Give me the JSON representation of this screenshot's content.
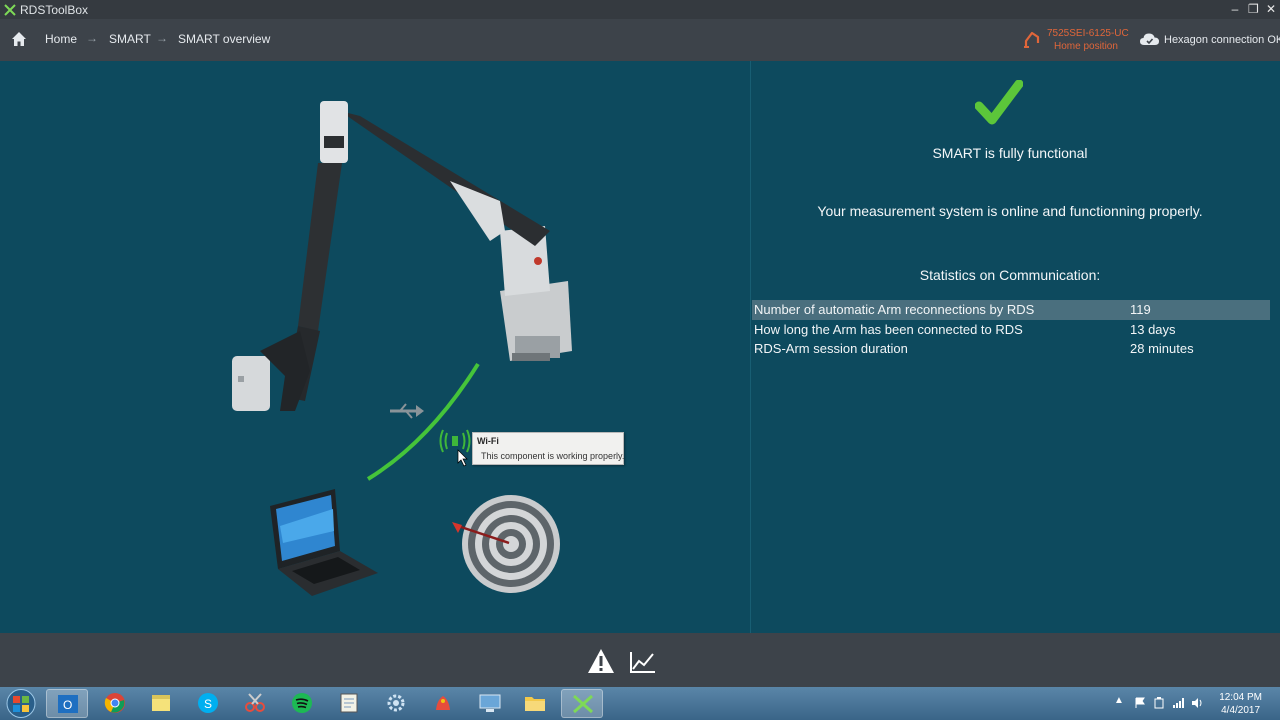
{
  "window": {
    "title": "RDSToolBox",
    "controls": [
      "minimize",
      "restore",
      "close"
    ]
  },
  "nav": {
    "breadcrumb": [
      "Home",
      "SMART",
      "SMART overview"
    ],
    "separator": "→",
    "device_id": "7525SEI-6125-UC",
    "device_status": "Home position",
    "connection_status": "Hexagon connection OK"
  },
  "status": {
    "title": "SMART is fully functional",
    "description": "Your measurement system is online and functionning properly."
  },
  "stats": {
    "title": "Statistics on Communication:",
    "rows": [
      {
        "label": "Number of automatic Arm reconnections by RDS",
        "value": "119"
      },
      {
        "label": "How long the Arm has been connected to RDS",
        "value": "13 days"
      },
      {
        "label": "RDS-Arm session duration",
        "value": "28 minutes"
      }
    ]
  },
  "tooltip": {
    "title": "Wi-Fi",
    "body": "This component is working properly."
  },
  "footer": {
    "icons": [
      "warning-icon",
      "chart-icon"
    ]
  },
  "taskbar": {
    "apps": [
      "outlook",
      "chrome",
      "sticky-notes",
      "skype",
      "snipping-tool",
      "spotify",
      "notepad",
      "settings",
      "paint",
      "remote-desktop",
      "file-explorer",
      "rdstoolbox"
    ],
    "time": "12:04 PM",
    "date": "4/4/2017"
  },
  "colors": {
    "accent_orange": "#e0663a",
    "success_green": "#5cc63a",
    "background": "#0d4a5e"
  }
}
